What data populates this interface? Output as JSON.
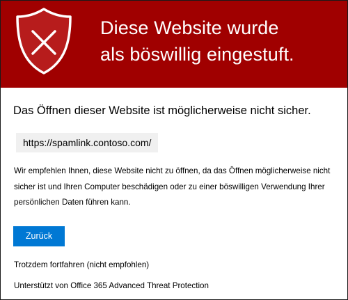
{
  "colors": {
    "banner_background": "#a00000",
    "banner_text": "#ffffff",
    "shield_fill": "#b71c1c",
    "shield_outline": "#ffffff",
    "button_background": "#0078d4",
    "url_box_background": "#f0f0f0"
  },
  "banner": {
    "icon": "shield-x-icon",
    "title_line_1": "Diese Website wurde",
    "title_line_2": "als böswillig eingestuft."
  },
  "content": {
    "heading": "Das Öffnen dieser Website ist möglicherweise nicht sicher.",
    "url": "https://spamlink.contoso.com/",
    "description_lines": [
      "Wir empfehlen Ihnen, diese Website nicht zu öffnen, da das Öffnen möglicherweise nicht",
      "sicher ist und Ihren Computer beschädigen oder zu einer böswilligen Verwendung Ihrer",
      "persönlichen Daten führen kann."
    ],
    "back_button_label": "Zurück",
    "continue_link_label": "Trotzdem fortfahren (nicht empfohlen)",
    "footer": "Unterstützt von Office 365 Advanced Threat Protection"
  }
}
